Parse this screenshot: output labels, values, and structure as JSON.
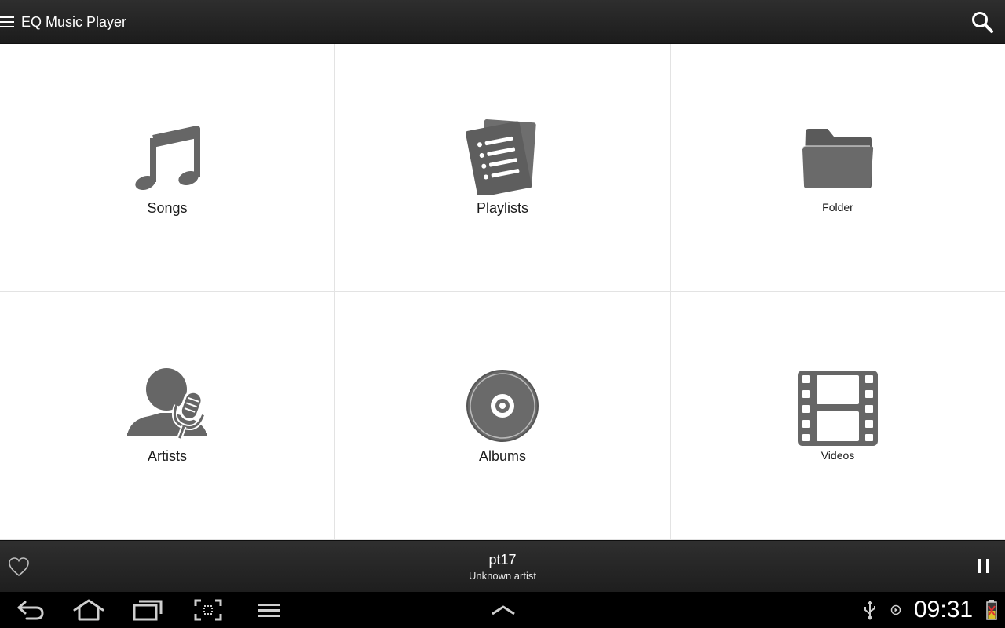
{
  "header": {
    "title": "EQ Music Player",
    "menu_icon": "hamburger-menu-icon",
    "search_icon": "search-icon"
  },
  "tiles": [
    {
      "label": "Songs",
      "icon": "music-note-icon"
    },
    {
      "label": "Playlists",
      "icon": "playlist-icon"
    },
    {
      "label": "Folder",
      "icon": "folder-icon"
    },
    {
      "label": "Artists",
      "icon": "artist-microphone-icon"
    },
    {
      "label": "Albums",
      "icon": "album-disc-icon"
    },
    {
      "label": "Videos",
      "icon": "film-strip-icon"
    }
  ],
  "now_playing": {
    "title": "pt17",
    "artist": "Unknown artist",
    "favorite_icon": "heart-outline-icon",
    "pause_icon": "pause-icon"
  },
  "system_bar": {
    "time": "09:31",
    "buttons": [
      "back-icon",
      "home-icon",
      "recent-apps-icon",
      "screenshot-icon",
      "menu-icon",
      "chevron-up-icon"
    ],
    "status_icons": [
      "usb-icon",
      "media-icon",
      "battery-icon"
    ]
  },
  "colors": {
    "bar_background": "#232323",
    "grid_background": "#ffffff",
    "icon_gray": "#666666",
    "divider": "#e3e3e3"
  }
}
